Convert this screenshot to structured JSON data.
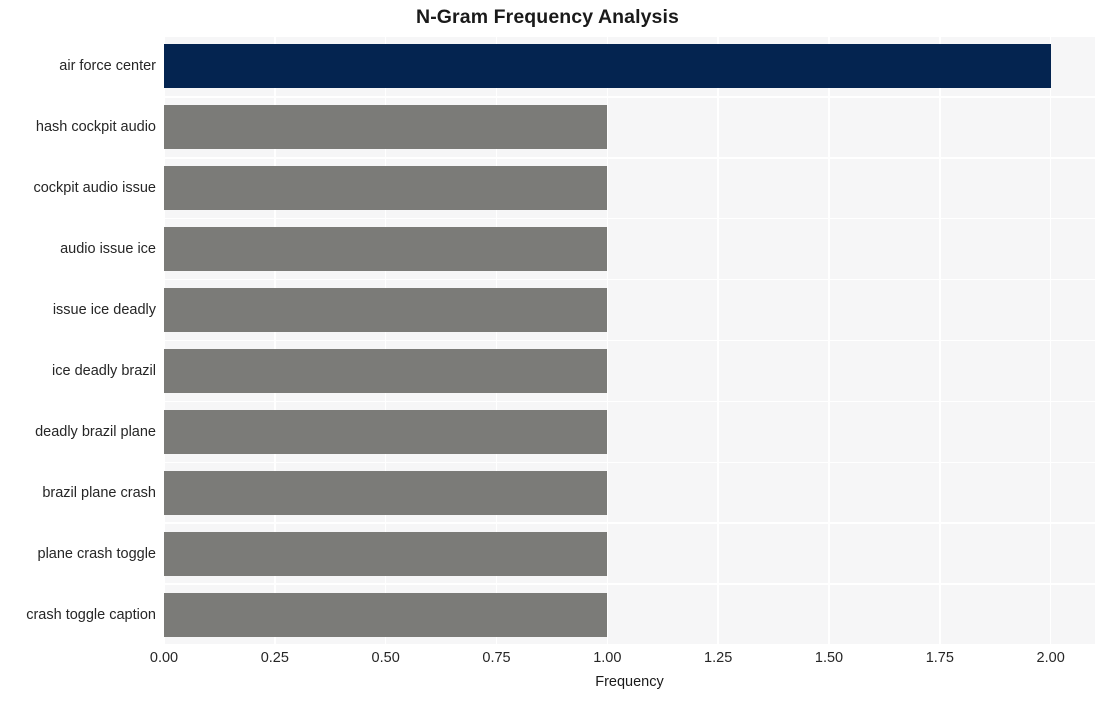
{
  "chart_data": {
    "type": "bar",
    "orientation": "horizontal",
    "title": "N-Gram Frequency Analysis",
    "xlabel": "Frequency",
    "ylabel": "",
    "categories": [
      "air force center",
      "hash cockpit audio",
      "cockpit audio issue",
      "audio issue ice",
      "issue ice deadly",
      "ice deadly brazil",
      "deadly brazil plane",
      "brazil plane crash",
      "plane crash toggle",
      "crash toggle caption"
    ],
    "values": [
      2,
      1,
      1,
      1,
      1,
      1,
      1,
      1,
      1,
      1
    ],
    "bar_colors": [
      "#042450",
      "#7b7b78",
      "#7b7b78",
      "#7b7b78",
      "#7b7b78",
      "#7b7b78",
      "#7b7b78",
      "#7b7b78",
      "#7b7b78",
      "#7b7b78"
    ],
    "xlim": [
      0.0,
      2.1
    ],
    "xticks": [
      0.0,
      0.25,
      0.5,
      0.75,
      1.0,
      1.25,
      1.5,
      1.75,
      2.0
    ],
    "xticklabels": [
      "0.00",
      "0.25",
      "0.50",
      "0.75",
      "1.00",
      "1.25",
      "1.50",
      "1.75",
      "2.00"
    ],
    "grid": true,
    "grid_color": "#ffffff",
    "plot_background": "#f6f6f7",
    "figure_background": "#ffffff",
    "legend": null,
    "highlight_color": "#042450",
    "default_color": "#7b7b78"
  }
}
